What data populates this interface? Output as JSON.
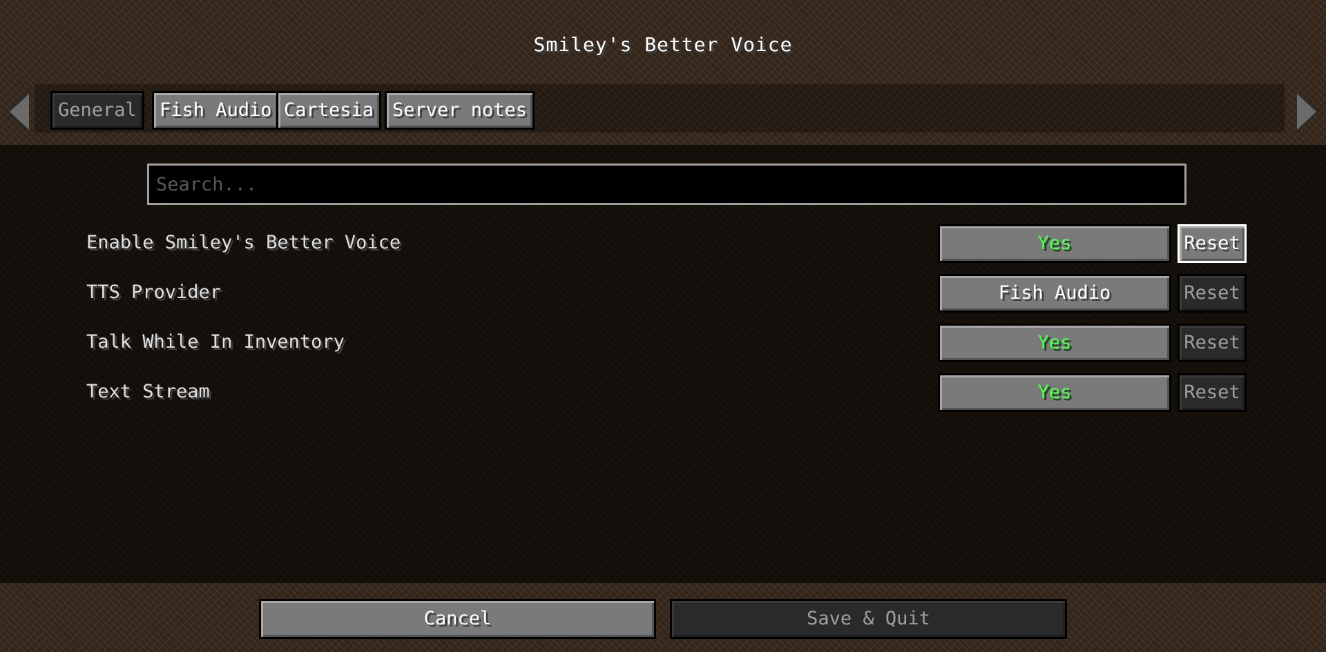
{
  "title": "Smiley's Better Voice",
  "nav": {
    "prev_icon": "arrow-left-icon",
    "next_icon": "arrow-right-icon"
  },
  "tabs": [
    {
      "label": "General",
      "active": true
    },
    {
      "label": "Fish Audio",
      "active": false
    },
    {
      "label": "Cartesia",
      "active": false
    },
    {
      "label": "Server notes",
      "active": false
    }
  ],
  "search": {
    "placeholder": "Search...",
    "value": ""
  },
  "options": [
    {
      "label": "Enable Smiley's Better Voice",
      "value": "Yes",
      "reset": "Reset",
      "reset_enabled": true
    },
    {
      "label": "TTS Provider",
      "value": "Fish Audio",
      "reset": "Reset",
      "reset_enabled": false
    },
    {
      "label": "Talk While In Inventory",
      "value": "Yes",
      "reset": "Reset",
      "reset_enabled": false
    },
    {
      "label": "Text Stream",
      "value": "Yes",
      "reset": "Reset",
      "reset_enabled": false
    }
  ],
  "footer": {
    "cancel_label": "Cancel",
    "save_label": "Save & Quit"
  },
  "colors": {
    "yes_green": "#55ff55",
    "disabled_text": "#a0a0a0",
    "button_face": "#7a7a7a"
  }
}
